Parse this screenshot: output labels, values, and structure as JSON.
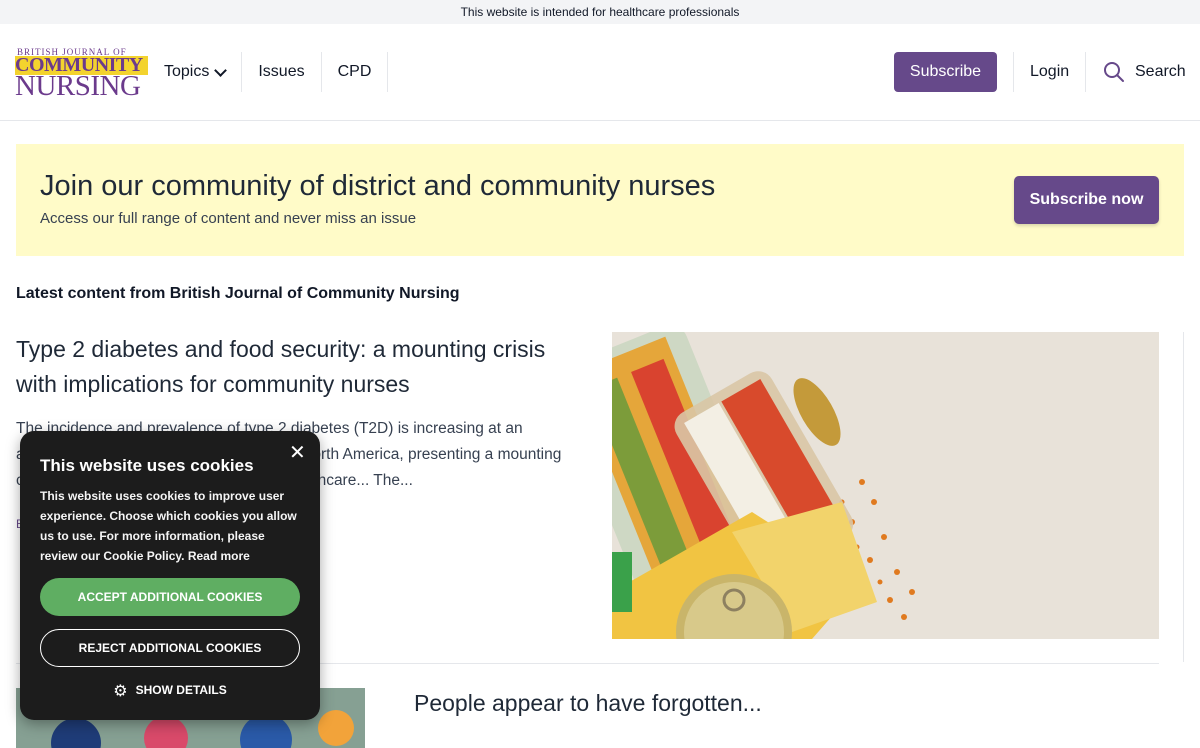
{
  "topbar": {
    "text": "This website is intended for healthcare professionals"
  },
  "logo": {
    "line1": "BRITISH JOURNAL OF",
    "line2": "COMMUNITY",
    "line3": "NURSING"
  },
  "nav": {
    "topics": "Topics",
    "issues": "Issues",
    "cpd": "CPD"
  },
  "header": {
    "subscribe": "Subscribe",
    "login": "Login",
    "search": "Search"
  },
  "banner": {
    "title": "Join our community of district and community nurses",
    "subtitle": "Access our full range of content and never miss an issue",
    "button": "Subscribe now"
  },
  "section_title": "Latest content from British Journal of Community Nursing",
  "articles": [
    {
      "title": "Type 2 diabetes and food security: a mounting crisis with implications for community nurses",
      "excerpt": "The incidence and prevalence of type 2 diabetes (T2D) is increasing at an alarming rate across the UK, Europe and North America, presenting a mounting crisis and a considerable challenge for healthcare... The...",
      "meta": "E"
    },
    {
      "title": "People appear to have forgotten..."
    }
  ],
  "cookie": {
    "title": "This website uses cookies",
    "body": "This website uses cookies to improve user experience. Choose which cookies you allow us to use. For more information, please review our Cookie Policy. Read more",
    "accept": "ACCEPT ADDITIONAL COOKIES",
    "reject": "REJECT ADDITIONAL COOKIES",
    "details": "SHOW DETAILS",
    "close": "✕"
  },
  "colors": {
    "brand_purple": "#66498a",
    "banner_bg": "#fffbc8",
    "accept_green": "#5fae62",
    "logo_yellow": "#f3d32e"
  }
}
